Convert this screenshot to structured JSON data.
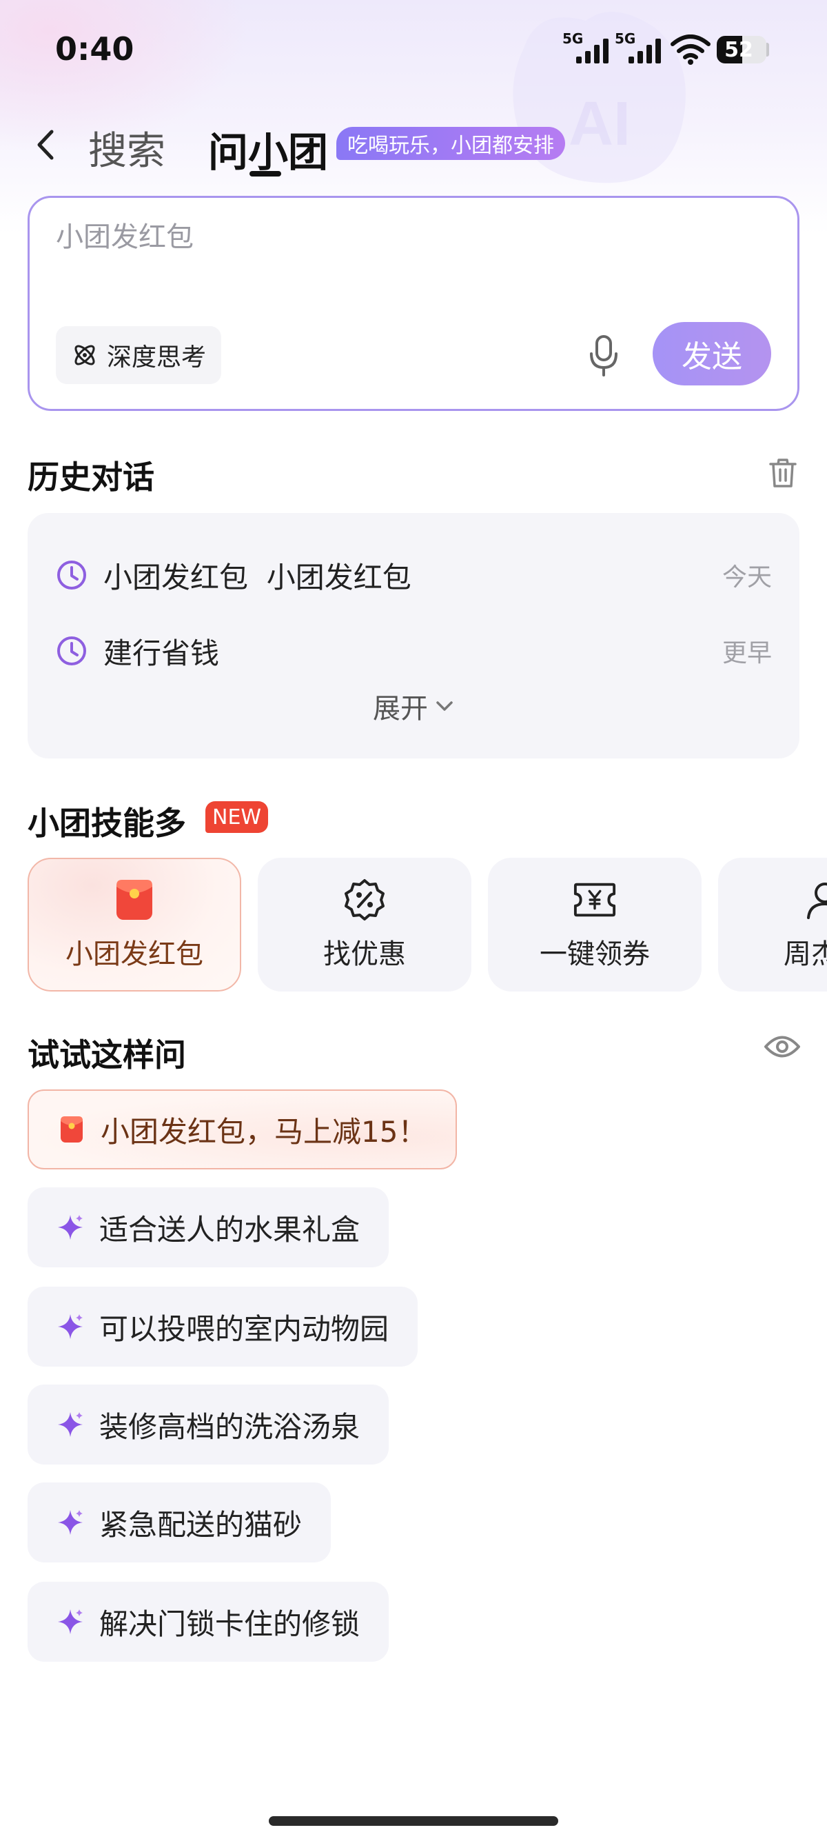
{
  "status_bar": {
    "time": "0:40",
    "signal_1_tag": "5G",
    "signal_2_tag": "5G",
    "battery": "52",
    "battery_level": 0.52
  },
  "header": {
    "back_icon": "chevron-left-icon",
    "tab_search": "搜索",
    "tab_ask": "问小团",
    "badge": "吃喝玩乐，小团都安排",
    "accent_color": "#8a78f5"
  },
  "input": {
    "placeholder": "小团发红包",
    "deep_think_label": "深度思考",
    "deep_think_icon": "atom-icon",
    "mic_icon": "microphone-icon",
    "send_label": "发送"
  },
  "history": {
    "title": "历史对话",
    "delete_icon": "trash-icon",
    "items": [
      {
        "label": "小团发红包  小团发红包",
        "when": "今天"
      },
      {
        "label": "建行省钱",
        "when": "更早"
      }
    ],
    "expand_label": "展开"
  },
  "skills": {
    "title": "小团技能多",
    "new_badge": "NEW",
    "items": [
      {
        "label": "小团发红包",
        "icon": "red-packet-icon"
      },
      {
        "label": "找优惠",
        "icon": "discount-icon"
      },
      {
        "label": "一键领券",
        "icon": "coupon-icon"
      },
      {
        "label": "周杰伦",
        "icon": "person-icon"
      }
    ]
  },
  "prompts": {
    "title": "试试这样问",
    "visibility_icon": "eye-icon",
    "items": [
      {
        "label": "小团发红包，马上减15！",
        "icon": "red-packet-icon"
      },
      {
        "label": "适合送人的水果礼盒",
        "icon": "sparkle-icon"
      },
      {
        "label": "可以投喂的室内动物园",
        "icon": "sparkle-icon"
      },
      {
        "label": "装修高档的洗浴汤泉",
        "icon": "sparkle-icon"
      },
      {
        "label": "紧急配送的猫砂",
        "icon": "sparkle-icon"
      },
      {
        "label": "解决门锁卡住的修锁",
        "icon": "sparkle-icon"
      }
    ]
  }
}
